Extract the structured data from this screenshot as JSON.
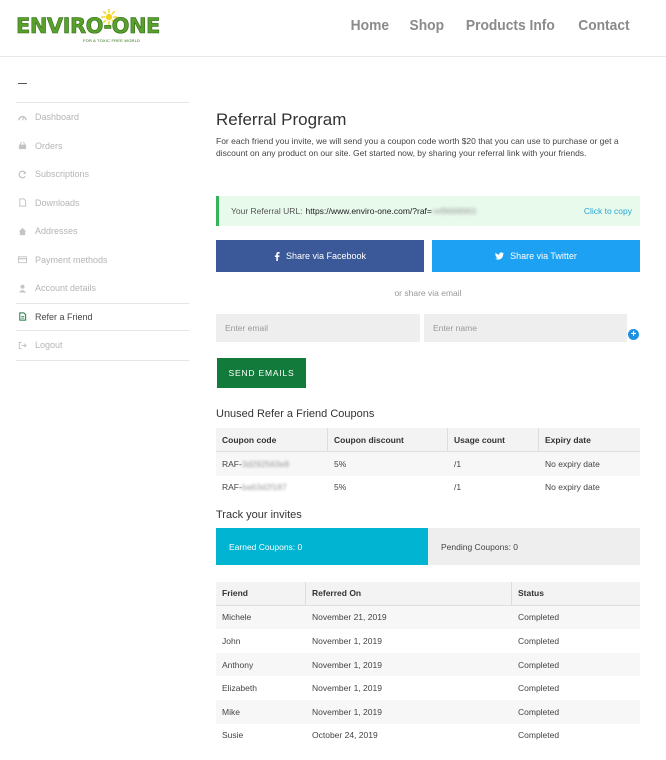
{
  "brand": {
    "name": "ENVIRO-ONE",
    "tagline": "FOR A TOXIC FREE WORLD",
    "color": "#5aa02c"
  },
  "nav": [
    "Home",
    "Shop",
    "Products Info",
    "Contact"
  ],
  "sidebar": {
    "items": [
      {
        "label": "Dashboard",
        "icon": "tachometer-icon"
      },
      {
        "label": "Orders",
        "icon": "basket-icon"
      },
      {
        "label": "Subscriptions",
        "icon": "refresh-icon"
      },
      {
        "label": "Downloads",
        "icon": "file-icon"
      },
      {
        "label": "Addresses",
        "icon": "home-icon"
      },
      {
        "label": "Payment methods",
        "icon": "credit-card-icon"
      },
      {
        "label": "Account details",
        "icon": "user-icon"
      },
      {
        "label": "Refer a Friend",
        "icon": "document-icon",
        "active": true
      },
      {
        "label": "Logout",
        "icon": "sign-out-icon"
      }
    ]
  },
  "main": {
    "title": "Referral Program",
    "intro": "For each friend you invite, we will send you a coupon code worth $20 that you can use to purchase or get a discount on any product on our site. Get started now, by sharing your referral link with your friends.",
    "referral": {
      "label": "Your Referral URL:",
      "url": "https://www.enviro-one.com/?raf=",
      "code_hidden": "ref9668963",
      "copy_label": "Click to copy"
    },
    "share": {
      "facebook": "Share via Facebook",
      "twitter": "Share via Twitter"
    },
    "or_email": "or share via email",
    "email_placeholder": "Enter email",
    "name_placeholder": "Enter name",
    "send_label": "SEND EMAILS",
    "coupons": {
      "heading": "Unused Refer a Friend Coupons",
      "columns": [
        "Coupon code",
        "Coupon discount",
        "Usage count",
        "Expiry date"
      ],
      "rows": [
        {
          "prefix": "RAF-",
          "code": "3d292563e8",
          "discount": "5%",
          "usage": "/1",
          "expiry": "No expiry date"
        },
        {
          "prefix": "RAF-",
          "code": "ba63d2f187",
          "discount": "5%",
          "usage": "/1",
          "expiry": "No expiry date"
        }
      ]
    },
    "track": {
      "heading": "Track your invites",
      "earned": "Earned Coupons: 0",
      "pending": "Pending Coupons: 0"
    },
    "invites": {
      "columns": [
        "Friend",
        "Referred On",
        "Status"
      ],
      "rows": [
        {
          "friend": "Michele",
          "date": "November 21, 2019",
          "status": "Completed"
        },
        {
          "friend": "John",
          "date": "November 1, 2019",
          "status": "Completed"
        },
        {
          "friend": "Anthony",
          "date": "November 1, 2019",
          "status": "Completed"
        },
        {
          "friend": "Elizabeth",
          "date": "November 1, 2019",
          "status": "Completed"
        },
        {
          "friend": "Mike",
          "date": "November 1, 2019",
          "status": "Completed"
        },
        {
          "friend": "Susie",
          "date": "October 24, 2019",
          "status": "Completed"
        }
      ]
    }
  },
  "colors": {
    "facebook": "#3b5998",
    "twitter": "#1da1f2",
    "send": "#127a3a",
    "earned_tab": "#00b4d2",
    "referral_bg": "#e8faec"
  }
}
